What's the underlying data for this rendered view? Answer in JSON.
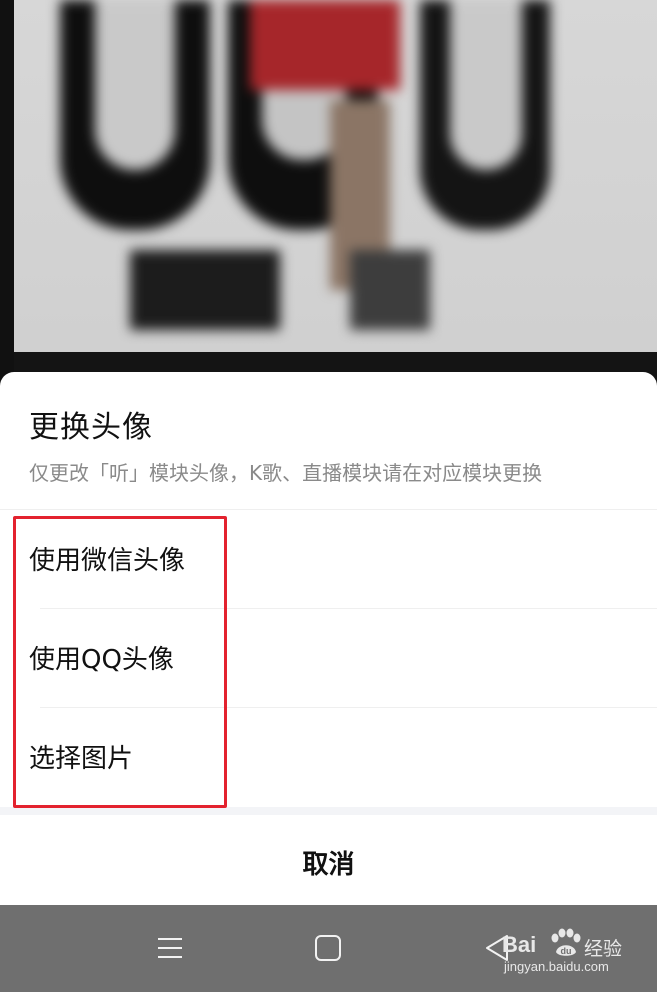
{
  "sheet": {
    "title": "更换头像",
    "subtitle": "仅更改「听」模块头像，K歌、直播模块请在对应模块更换",
    "options": [
      {
        "label": "使用微信头像"
      },
      {
        "label": "使用QQ头像"
      },
      {
        "label": "选择图片"
      }
    ],
    "cancel_label": "取消"
  },
  "nav_bar": {
    "icons": [
      "menu-icon",
      "home-square-icon",
      "back-triangle-icon"
    ]
  },
  "watermark": {
    "brand_left": "Bai",
    "brand_mid": "du",
    "brand_right": "经验",
    "site": "jingyan.baidu.com"
  },
  "colors": {
    "highlight": "#e3222e",
    "nav_bar": "#6f6f6f",
    "sheet_bg": "#ffffff"
  }
}
